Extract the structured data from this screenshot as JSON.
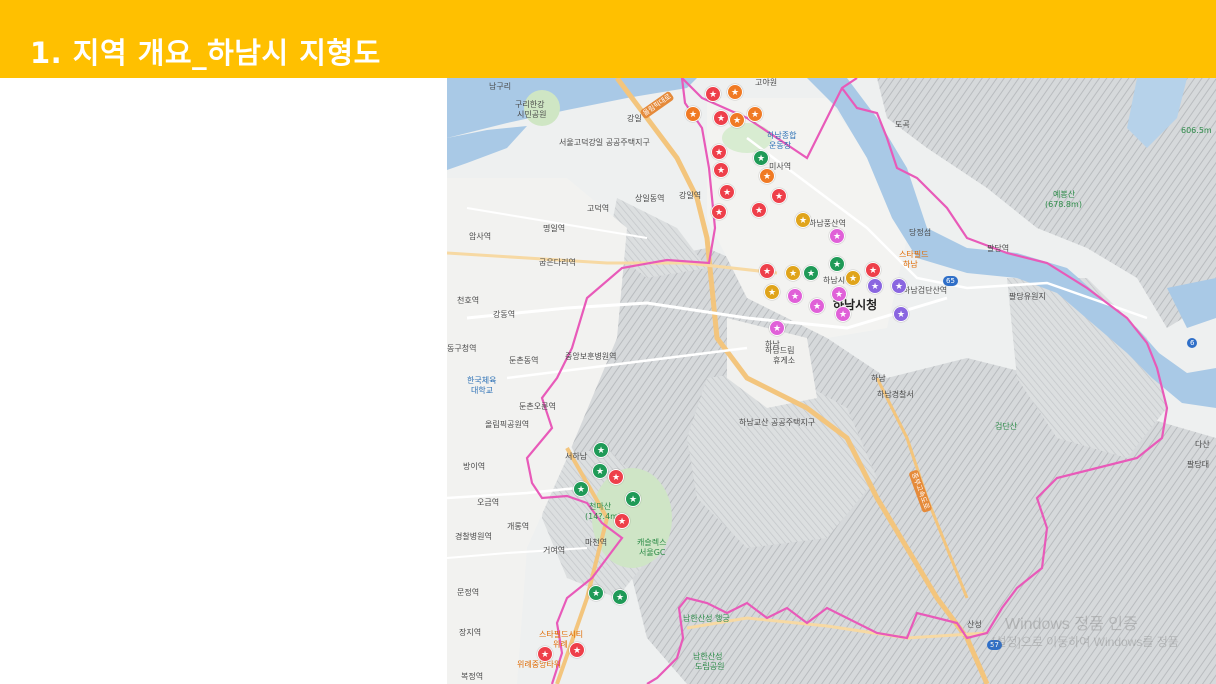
{
  "header": {
    "title": "1. 지역 개요_하남시 지형도",
    "background": "#FFC000"
  },
  "map": {
    "boundary_color": "#E85AB9",
    "place_labels": {
      "namguri": "남구리",
      "guri_hangang": "구리한강",
      "simin_park": "시민공원",
      "goyawon": "고야원",
      "gangil": "강일",
      "hanam_sports": "하남종합",
      "sports_ground": "운동장",
      "gangdong_housing": "서울고덕강일 공공주택지구",
      "misa_station": "미사역",
      "sangil_station": "상일동역",
      "gangil_station": "강일역",
      "godeok_station": "고덕역",
      "myeongil_station": "명일역",
      "gubeundari_station": "굽은다리역",
      "amsa_station": "암사역",
      "cheonho_station": "천호역",
      "gangdong_station": "강동역",
      "gildong": "동구청역",
      "dunchondong_station": "둔촌동역",
      "jungang_hospital": "중앙보훈병원역",
      "knsu1": "한국체육",
      "knsu2": "대학교",
      "dunchon_oryun": "둔촌오륜역",
      "olympic_park": "올림픽공원역",
      "seohanam": "서하남",
      "bangi": "방이역",
      "ogeum": "오금역",
      "gaerong": "개롱역",
      "macheon": "마천역",
      "geoyeo": "거여역",
      "gyeongchal_hospital": "경찰병원역",
      "munjeong": "문정역",
      "jangji": "장지역",
      "bokjeong": "복정역",
      "starfield_city_wirye1": "스타필드시티",
      "starfield_city_wirye2": "위례",
      "wirye_tower": "위례중앙타워",
      "cheonmasan": "천마산",
      "cheonmasan_height": "(14?.4m)",
      "castlex1": "캐슬렉스",
      "castlex2": "서울GC",
      "hanam_pungsan": "하남풍산역",
      "hanam_sicheong_station": "하남시청",
      "hanam_city_hall": "하남시청",
      "starfield_hanam1": "스타필드",
      "starfield_hanam2": "하남",
      "hanam_geomdan": "하남검단산역",
      "hanam_dream1": "하남드림",
      "hanam_dream2": "휴게소",
      "hanam_ic": "하남",
      "hanam_police": "하남경찰서",
      "gyosan_housing": "하남교산 공공주택지구",
      "dangjeong": "당정섬",
      "paldang_station": "팔당역",
      "paldang_dam": "팔당유원지",
      "yebongsan1": "예봉산",
      "yebongsan2": "(678.8m)",
      "geomdansan": "검단산",
      "docheon": "도곡",
      "deoksojeon": "덕소",
      "dasan": "다산",
      "paldangdae": "팔당대",
      "namhansanseong1": "남한산성 행궁",
      "namhansanseong2": "남한산성",
      "namhansanseong3": "도립공원",
      "sanseong": "산성",
      "road_olympic": "올림픽대로",
      "road_jungbu": "중부고속도로",
      "route_65": "65",
      "route_6": "6",
      "route_57": "57",
      "hanam_small": "하남",
      "mountain_606": "606.5m"
    },
    "watermark": {
      "line1": "Windows 정품 인증",
      "line2": "[설정]으로 이동하여 Windows를 정품"
    },
    "markers": [
      {
        "color": "red"
      },
      {
        "color": "orange"
      },
      {
        "color": "orange"
      },
      {
        "color": "red"
      },
      {
        "color": "orange"
      },
      {
        "color": "orange"
      },
      {
        "color": "red"
      },
      {
        "color": "green"
      },
      {
        "color": "red"
      },
      {
        "color": "orange"
      },
      {
        "color": "red"
      },
      {
        "color": "red"
      },
      {
        "color": "red"
      },
      {
        "color": "red"
      },
      {
        "color": "yellow"
      },
      {
        "color": "pink"
      },
      {
        "color": "red"
      },
      {
        "color": "yellow"
      },
      {
        "color": "green"
      },
      {
        "color": "green"
      },
      {
        "color": "red"
      },
      {
        "color": "yellow"
      },
      {
        "color": "yellow"
      },
      {
        "color": "pink"
      },
      {
        "color": "pink"
      },
      {
        "color": "pink"
      },
      {
        "color": "purple"
      },
      {
        "color": "purple"
      },
      {
        "color": "pink"
      },
      {
        "color": "purple"
      },
      {
        "color": "pink"
      },
      {
        "color": "green"
      },
      {
        "color": "green"
      },
      {
        "color": "red"
      },
      {
        "color": "green"
      },
      {
        "color": "green"
      },
      {
        "color": "red"
      },
      {
        "color": "green"
      },
      {
        "color": "green"
      },
      {
        "color": "red"
      },
      {
        "color": "red"
      }
    ],
    "marker_symbol": "★"
  }
}
